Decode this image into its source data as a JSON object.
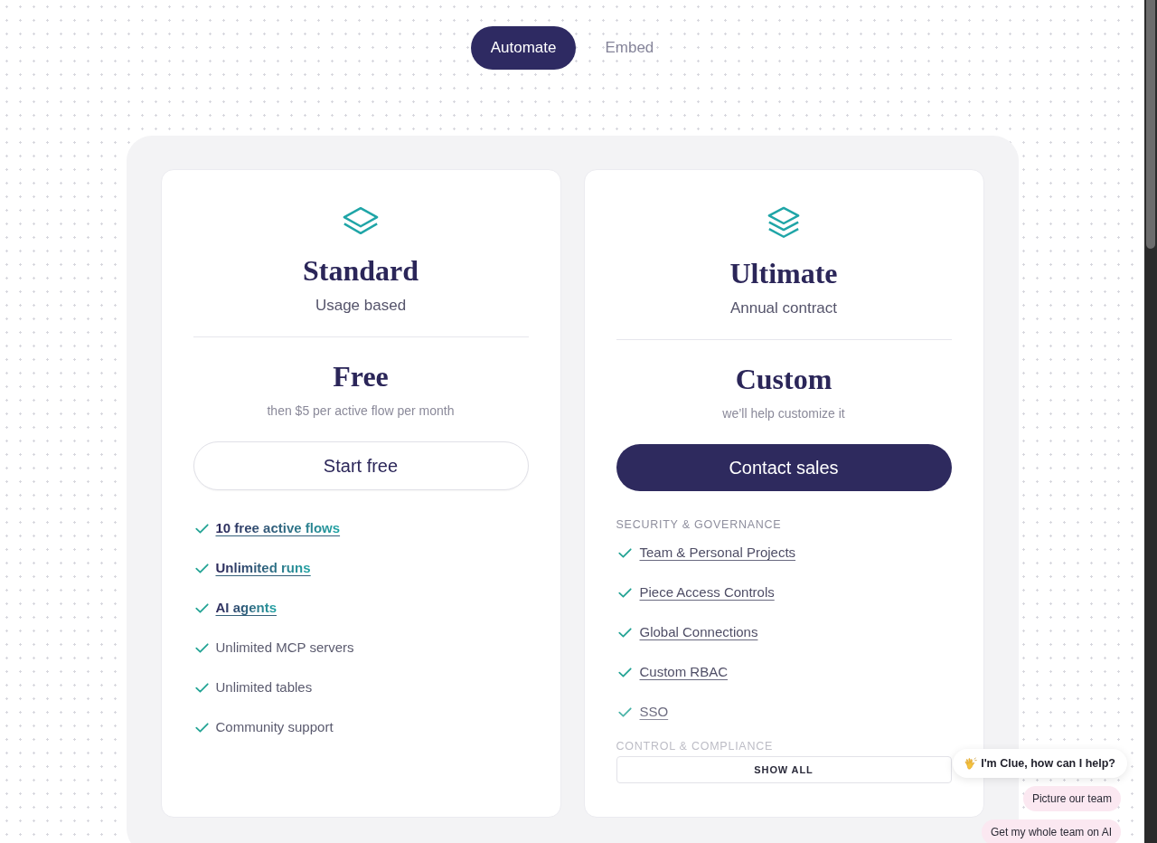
{
  "tabs": [
    {
      "label": "Automate",
      "selected": true
    },
    {
      "label": "Embed",
      "selected": false
    }
  ],
  "plans": [
    {
      "kind": "basic",
      "name": "Standard",
      "billing": "Usage based",
      "price": "Free",
      "price_note": "then $5 per active flow per month",
      "cta": "Start free",
      "features": [
        {
          "label": "10 free active flows",
          "kind": "link"
        },
        {
          "label": "Unlimited runs",
          "kind": "link"
        },
        {
          "label": "AI agents",
          "kind": "link"
        },
        {
          "label": "Unlimited MCP servers",
          "kind": "plain"
        },
        {
          "label": "Unlimited tables",
          "kind": "plain"
        },
        {
          "label": "Community support",
          "kind": "plain"
        }
      ]
    },
    {
      "kind": "premium",
      "name": "Ultimate",
      "billing": "Annual contract",
      "price": "Custom",
      "price_note": "we’ll help customize it",
      "cta": "Contact sales",
      "feature_sections": [
        {
          "heading": "SECURITY & GOVERNANCE",
          "items": [
            "Team & Personal Projects",
            "Piece Access Controls",
            "Global Connections",
            "Custom RBAC",
            "SSO"
          ]
        },
        {
          "heading": "CONTROL & COMPLIANCE"
        }
      ],
      "expanded": false,
      "show_all": "SHOW ALL"
    }
  ],
  "chat_widget": {
    "greeting": "I'm Clue, how can I help?",
    "suggestions": [
      "Picture our team",
      "Get my whole team on AI"
    ]
  }
}
